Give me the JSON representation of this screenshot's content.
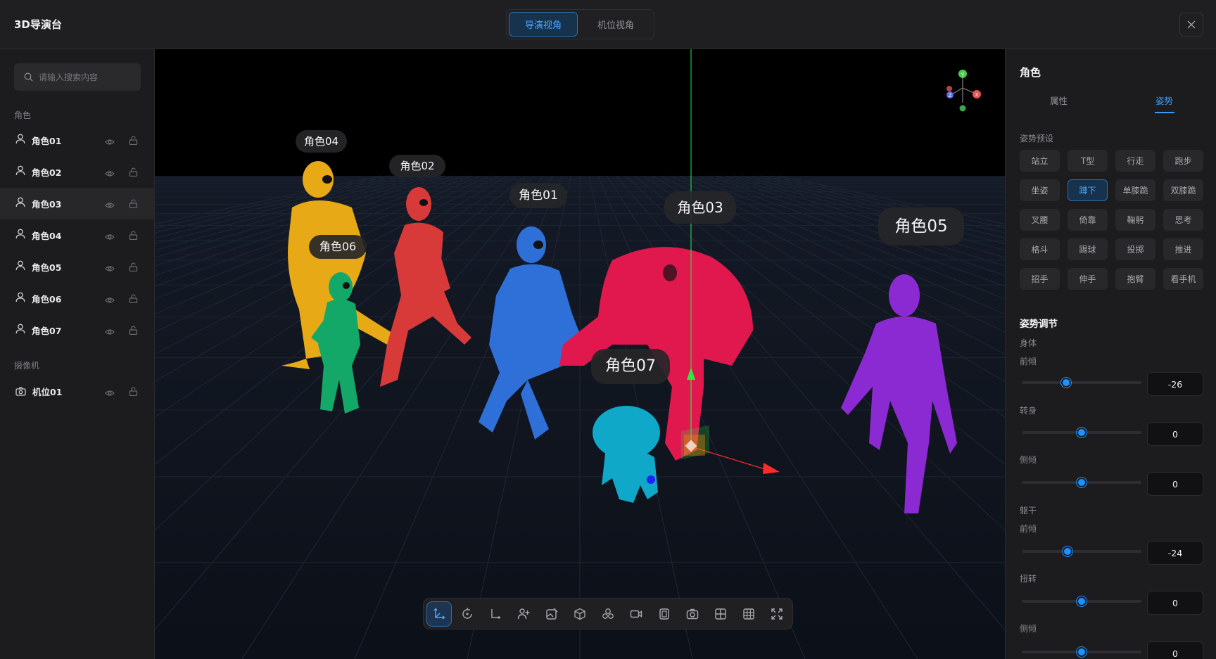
{
  "app": {
    "title": "3D导演台",
    "close_icon": "close-icon"
  },
  "view_switch": {
    "director": "导演视角",
    "camera": "机位视角",
    "active": "导演视角"
  },
  "sidebar": {
    "search_placeholder": "请输入搜索内容",
    "characters_label": "角色",
    "characters": [
      {
        "label": "角色01"
      },
      {
        "label": "角色02"
      },
      {
        "label": "角色03",
        "selected": true
      },
      {
        "label": "角色04"
      },
      {
        "label": "角色05"
      },
      {
        "label": "角色06"
      },
      {
        "label": "角色07"
      }
    ],
    "cameras_label": "摄像机",
    "cameras": [
      {
        "label": "机位01"
      }
    ]
  },
  "viewport": {
    "tags": {
      "r01": "角色01",
      "r02": "角色02",
      "r03": "角色03",
      "r04": "角色04",
      "r05": "角色05",
      "r06": "角色06",
      "r07": "角色07"
    },
    "gizmo_axes": {
      "y": "Y",
      "z": "Z",
      "x": "X"
    },
    "colors": {
      "r01": "#2f6fd8",
      "r02": "#d83a3a",
      "r03": "#e0184d",
      "r04": "#e8a916",
      "r05": "#8b2ad2",
      "r06": "#14a868",
      "r07": "#0fa8c8"
    },
    "toolbar": [
      "move-axis-icon",
      "rotate-icon",
      "axis-icon",
      "add-person-icon",
      "image-edit-icon",
      "cube-icon",
      "group-icon",
      "video-camera-icon",
      "frame-icon",
      "camera-icon",
      "grid-quad-icon",
      "grid-nine-icon",
      "fullscreen-icon"
    ]
  },
  "panel": {
    "title": "角色",
    "tabs": {
      "attributes": "属性",
      "pose": "姿势",
      "active": "姿势"
    },
    "presets_label": "姿势预设",
    "presets": [
      "站立",
      "T型",
      "行走",
      "跑步",
      "坐姿",
      "蹲下",
      "单膝跪",
      "双膝跪",
      "叉腰",
      "倚靠",
      "鞠躬",
      "思考",
      "格斗",
      "踢球",
      "投掷",
      "推进",
      "招手",
      "伸手",
      "抱臂",
      "看手机"
    ],
    "active_preset": "蹲下",
    "adjust_title": "姿势调节",
    "body": {
      "label": "身体",
      "sliders": [
        {
          "label": "前倾",
          "value": "-26",
          "fraction": 0.37
        },
        {
          "label": "转身",
          "value": "0",
          "fraction": 0.5
        },
        {
          "label": "侧倾",
          "value": "0",
          "fraction": 0.5
        }
      ]
    },
    "torso": {
      "label": "躯干",
      "sliders": [
        {
          "label": "前倾",
          "value": "-24",
          "fraction": 0.38
        },
        {
          "label": "扭转",
          "value": "0",
          "fraction": 0.5
        },
        {
          "label": "侧倾",
          "value": "0",
          "fraction": 0.5
        }
      ]
    }
  }
}
